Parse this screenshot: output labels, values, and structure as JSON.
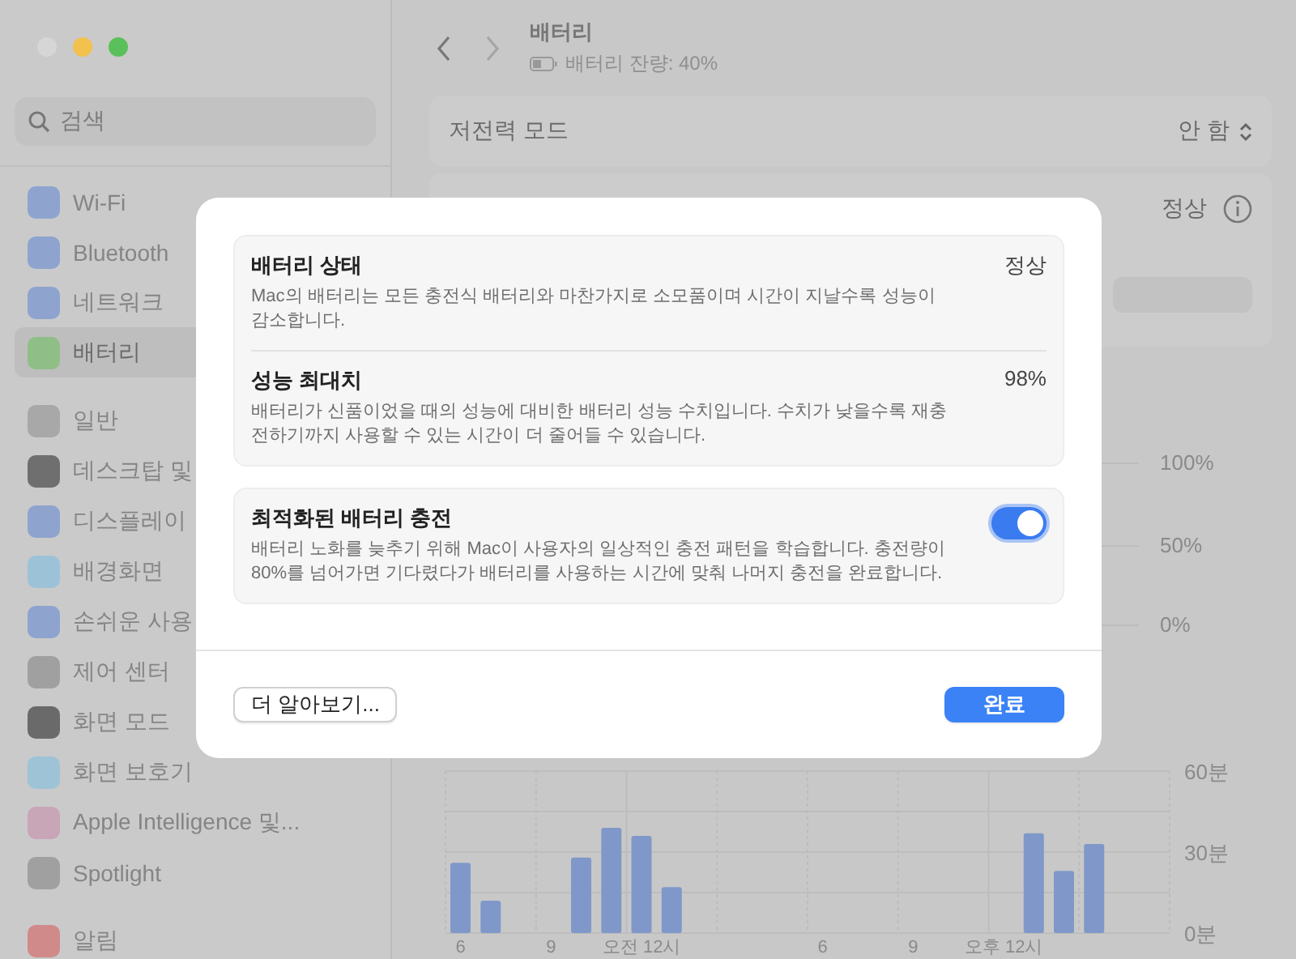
{
  "sidebar": {
    "search": {
      "placeholder": "검색"
    },
    "groups": [
      [
        {
          "label": "Wi-Fi",
          "color": "#8ea4cf",
          "selected": false
        },
        {
          "label": "Bluetooth",
          "color": "#8ea4cf",
          "selected": false
        },
        {
          "label": "네트워크",
          "color": "#8ea4cf",
          "selected": false
        },
        {
          "label": "배터리",
          "color": "#8fbf86",
          "selected": true
        }
      ],
      [
        {
          "label": "일반",
          "color": "#a8a8a8",
          "selected": false
        },
        {
          "label": "데스크탑 및",
          "color": "#6f6f6f",
          "selected": false
        },
        {
          "label": "디스플레이",
          "color": "#8ea4cf",
          "selected": false
        },
        {
          "label": "배경화면",
          "color": "#9cc2d8",
          "selected": false
        },
        {
          "label": "손쉬운 사용",
          "color": "#8ea4cf",
          "selected": false
        },
        {
          "label": "제어 센터",
          "color": "#a0a0a0",
          "selected": false
        },
        {
          "label": "화면 모드",
          "color": "#6a6a6a",
          "selected": false
        },
        {
          "label": "화면 보호기",
          "color": "#9ec3d6",
          "selected": false
        },
        {
          "label": "Apple Intelligence 및...",
          "color": "#c9a5b8",
          "selected": false
        },
        {
          "label": "Spotlight",
          "color": "#a0a0a0",
          "selected": false
        }
      ],
      [
        {
          "label": "알림",
          "color": "#d08a8a",
          "selected": false
        }
      ]
    ]
  },
  "header": {
    "title": "배터리",
    "subtitle": "배터리 잔량: 40%"
  },
  "low_power_mode": {
    "label": "저전력 모드",
    "value": "안 함"
  },
  "battery_health": {
    "value": "정상"
  },
  "battery_level_chart": {
    "y_labels": [
      "100%",
      "50%",
      "0%"
    ]
  },
  "screen_usage_chart": {
    "chart_data": {
      "type": "bar",
      "categories": [
        "6",
        null,
        null,
        "9",
        null,
        null,
        "오전 12시",
        null,
        null,
        null,
        null,
        null,
        "6",
        null,
        null,
        "9",
        null,
        null,
        "오후 12시",
        null,
        null,
        null,
        null,
        null
      ],
      "values": [
        26,
        12,
        0,
        0,
        28,
        39,
        36,
        17,
        0,
        0,
        0,
        0,
        0,
        0,
        0,
        0,
        0,
        0,
        0,
        37,
        23,
        33,
        0,
        0
      ],
      "ylim": [
        0,
        60
      ],
      "grid": true,
      "yticks": [
        {
          "value": 0,
          "label": "0분"
        },
        {
          "value": 30,
          "label": "30분"
        },
        {
          "value": 60,
          "label": "60분"
        }
      ]
    }
  },
  "dialog": {
    "info_rows": [
      {
        "title": "배터리 상태",
        "description": "Mac의 배터리는 모든 충전식 배터리와 마찬가지로 소모품이며 시간이 지날수록 성능이 감소합니다.",
        "value": "정상"
      },
      {
        "title": "성능 최대치",
        "description": "배터리가 신품이었을 때의 성능에 대비한 배터리 성능 수치입니다. 수치가 낮을수록 재충전하기까지 사용할 수 있는 시간이 더 줄어들 수 있습니다.",
        "value": "98%"
      }
    ],
    "charging": {
      "title": "최적화된 배터리 충전",
      "description": "배터리 노화를 늦추기 위해 Mac이 사용자의 일상적인 충전 패턴을 학습합니다. 충전량이 80%를 넘어가면 기다렸다가 배터리를 사용하는 시간에 맞춰 나머지 충전을 완료합니다.",
      "on": true
    },
    "buttons": [
      {
        "label": "더 알아보기...",
        "kind": "secondary"
      },
      {
        "label": "완료",
        "kind": "primary"
      }
    ]
  }
}
